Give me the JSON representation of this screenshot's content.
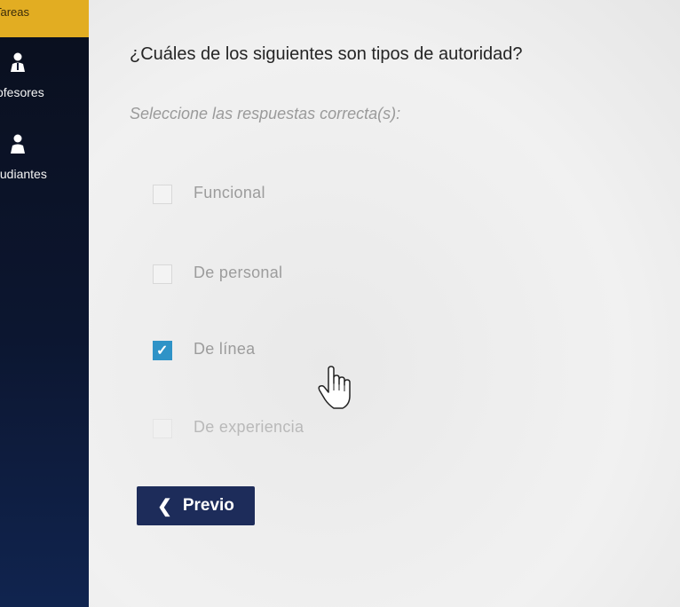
{
  "sidebar": {
    "tareas_label": "Tareas",
    "items": [
      {
        "label": "ofesores",
        "icon": "person-icon"
      },
      {
        "label": "tudiantes",
        "icon": "person-icon"
      }
    ]
  },
  "question": {
    "title": "¿Cuáles de los siguientes son tipos de autoridad?",
    "instruction": "Seleccione las respuestas correcta(s):",
    "options": [
      {
        "label": "Funcional",
        "checked": false
      },
      {
        "label": "De personal",
        "checked": false
      },
      {
        "label": "De línea",
        "checked": true
      },
      {
        "label": "De experiencia",
        "checked": false
      }
    ]
  },
  "navigation": {
    "prev_label": "Previo",
    "prev_icon": "chevron-left-icon"
  },
  "colors": {
    "sidebar_accent": "#e2ad22",
    "checkbox_checked": "#2f93c7",
    "button_bg": "#1d2c5a"
  }
}
